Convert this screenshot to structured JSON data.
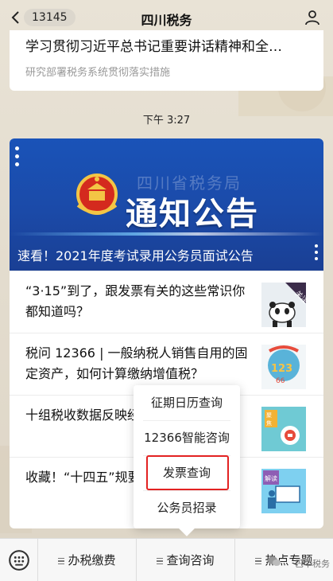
{
  "topbar": {
    "unread_count": "13145",
    "title": "四川税务"
  },
  "previous_message": {
    "title": "学习贯彻习近平总书记重要讲话精神和全…",
    "subtitle": "研究部署税务系统贯彻落实措施"
  },
  "timestamp": "下午 3:27",
  "article_card": {
    "banner": {
      "agency_text": "四川省税务局",
      "notice_text": "通知公告",
      "caption": "速看！2021年度考试录用公务员面试公告"
    },
    "items": [
      {
        "title": "“3·15”到了，跟发票有关的这些常识你都知道吗？",
        "thumb_label": "关注"
      },
      {
        "title": "税问 12366 | 一般纳税人销售自用的固定资产，如何计算缴纳增值税？",
        "thumb_label": ""
      },
      {
        "title": "十组税收数据反映经济社会发展取得",
        "thumb_label": "聚焦"
      },
      {
        "title": "收藏！“十四五”规要点都在这儿",
        "thumb_label": "解读"
      }
    ]
  },
  "popup_menu": {
    "items": [
      "征期日历查询",
      "12366智能咨询",
      "发票查询",
      "公务员招录"
    ],
    "highlighted_index": 2
  },
  "bottom_menu": {
    "tabs": [
      "办税缴费",
      "查询咨询",
      "热点专题"
    ]
  },
  "watermark": "巴中税务",
  "colors": {
    "banner_blue": "#1a53b8",
    "highlight_red": "#e32222"
  }
}
